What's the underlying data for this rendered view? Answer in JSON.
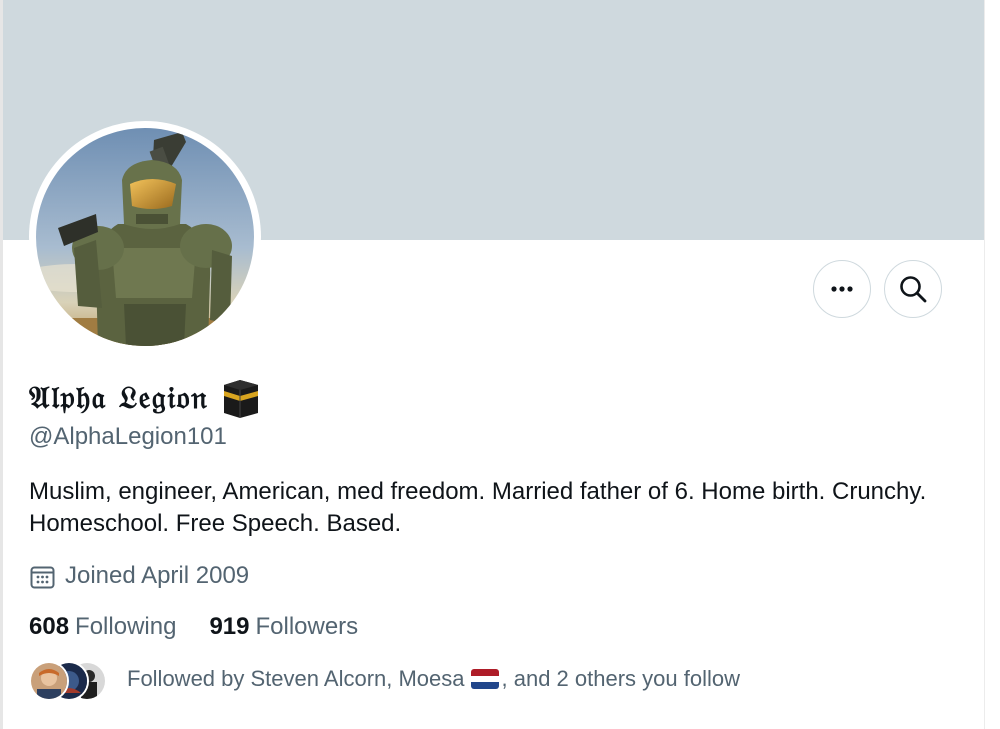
{
  "profile": {
    "display_name": "𝔄𝔩𝔭𝔥𝔞 𝔏𝔢𝔤𝔦𝔬𝔫",
    "display_name_emoji": "kaaba-icon",
    "handle": "@AlphaLegion101",
    "bio": "Muslim, engineer, American, med freedom. Married father of 6.  Home birth. Crunchy. Homeschool. Free Speech. Based.",
    "joined": "Joined April 2009",
    "banner_color": "#cfd9de"
  },
  "actions": {
    "more_icon": "more-horizontal-icon",
    "search_icon": "search-icon"
  },
  "stats": {
    "following_count": "608",
    "following_label": "Following",
    "followers_count": "919",
    "followers_label": "Followers"
  },
  "followed_by": {
    "prefix": "Followed by Steven Alcorn, Moesa",
    "flag": "netherlands-flag-icon",
    "suffix": ", and 2 others you follow"
  },
  "colors": {
    "text_primary": "#0f1419",
    "text_secondary": "#536471",
    "border": "#cfd9de"
  }
}
